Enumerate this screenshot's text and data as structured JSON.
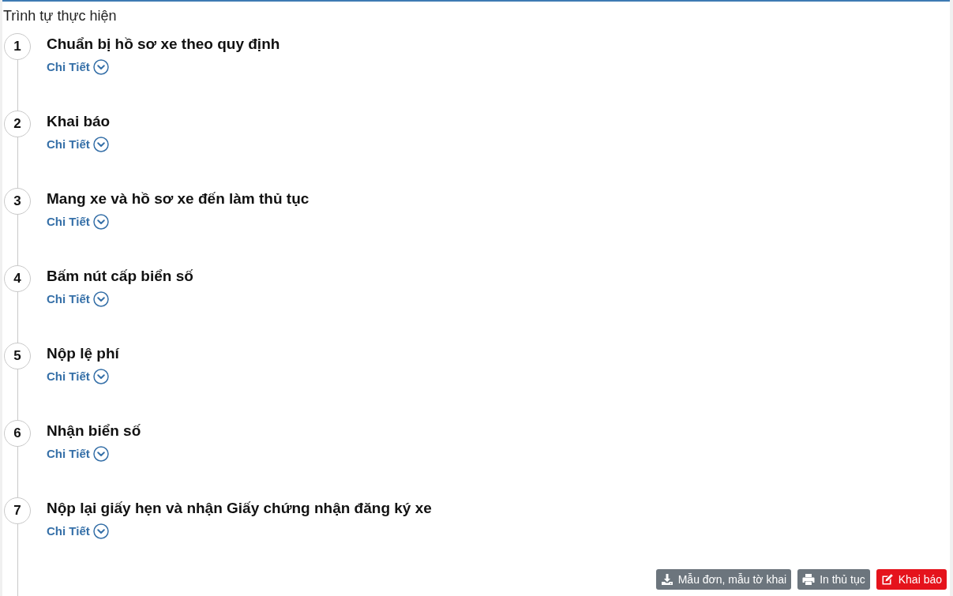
{
  "section": {
    "title": "Trình tự thực hiện"
  },
  "steps": [
    {
      "number": "1",
      "title": "Chuẩn bị hồ sơ xe theo quy định",
      "details_label": "Chi Tiết",
      "expanded": false
    },
    {
      "number": "2",
      "title": "Khai báo",
      "details_label": "Chi Tiết",
      "expanded": false
    },
    {
      "number": "3",
      "title": "Mang xe và hồ sơ xe đến làm thủ tục",
      "details_label": "Chi Tiết",
      "expanded": false
    },
    {
      "number": "4",
      "title": "Bấm nút cấp biển số",
      "details_label": "Chi Tiết",
      "expanded": false
    },
    {
      "number": "5",
      "title": "Nộp lệ phí",
      "details_label": "Chi Tiết",
      "expanded": false
    },
    {
      "number": "6",
      "title": "Nhận biển số",
      "details_label": "Chi Tiết",
      "expanded": false
    },
    {
      "number": "7",
      "title": "Nộp lại giấy hẹn và nhận Giấy chứng nhận đăng ký xe",
      "details_label": "Chi Tiết",
      "expanded": false
    }
  ],
  "actions": [
    {
      "kind": "download",
      "label": "Mẫu đơn, mẫu tờ khai"
    },
    {
      "kind": "print",
      "label": "In thủ tục"
    },
    {
      "kind": "declare",
      "label": "Khai báo"
    }
  ]
}
